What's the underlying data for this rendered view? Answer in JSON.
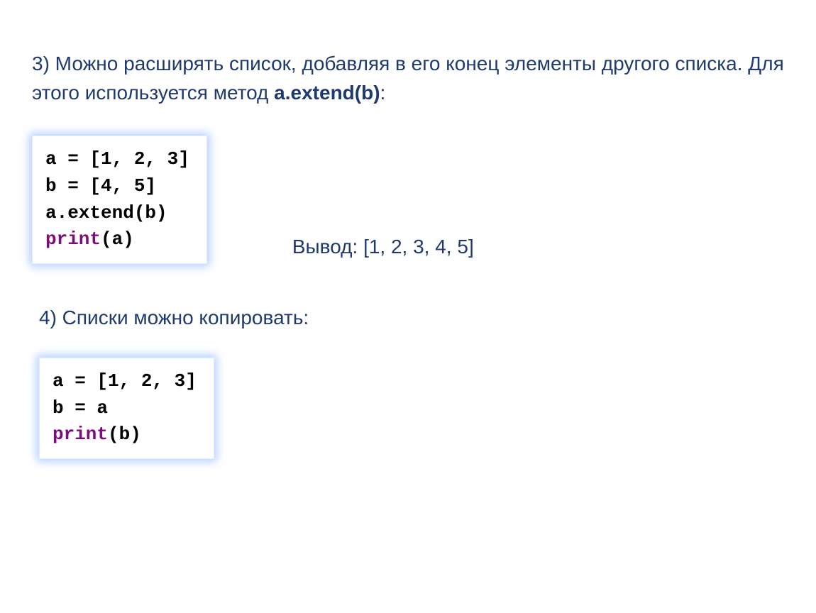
{
  "section3": {
    "text_part1": "3) Можно расширять список, добавляя в его конец элементы другого списка. Для этого используется метод ",
    "method": "a.extend(b)",
    "colon": ":",
    "code": {
      "line1": "a = [1, 2, 3]",
      "line2": "b = [4, 5]",
      "line3": "a.extend(b)",
      "line4_kw": "print",
      "line4_rest": "(a)"
    },
    "output_label": "Вывод: ",
    "output_value": "[1, 2, 3, 4, 5]"
  },
  "section4": {
    "heading": "4) Списки можно копировать:",
    "code": {
      "line1": "a = [1, 2, 3]",
      "line2": "b = a",
      "line3_kw": "print",
      "line3_rest": "(b)"
    }
  }
}
